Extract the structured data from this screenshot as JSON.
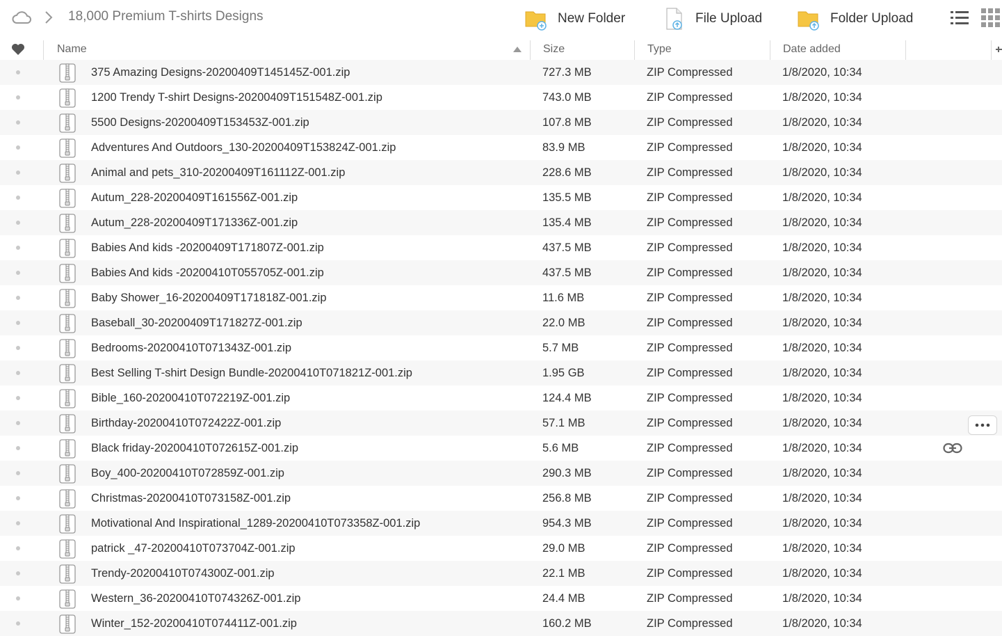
{
  "breadcrumb": {
    "title": "18,000 Premium T-shirts Designs"
  },
  "toolbar": {
    "new_folder": "New Folder",
    "file_upload": "File Upload",
    "folder_upload": "Folder Upload"
  },
  "colors": {
    "folder": "#f5c542",
    "accent_badge": "#5fb3e6",
    "stripe": "#f7f7f7"
  },
  "columns": {
    "name": "Name",
    "size": "Size",
    "type": "Type",
    "date": "Date added"
  },
  "files": [
    {
      "name": "375 Amazing Designs-20200409T145145Z-001.zip",
      "size": "727.3 MB",
      "type": "ZIP Compressed",
      "date": "1/8/2020, 10:34"
    },
    {
      "name": "1200 Trendy T-shirt Designs-20200409T151548Z-001.zip",
      "size": "743.0 MB",
      "type": "ZIP Compressed",
      "date": "1/8/2020, 10:34"
    },
    {
      "name": "5500 Designs-20200409T153453Z-001.zip",
      "size": "107.8 MB",
      "type": "ZIP Compressed",
      "date": "1/8/2020, 10:34"
    },
    {
      "name": "Adventures And Outdoors_130-20200409T153824Z-001.zip",
      "size": "83.9 MB",
      "type": "ZIP Compressed",
      "date": "1/8/2020, 10:34"
    },
    {
      "name": "Animal and pets_310-20200409T161112Z-001.zip",
      "size": "228.6 MB",
      "type": "ZIP Compressed",
      "date": "1/8/2020, 10:34"
    },
    {
      "name": "Autum_228-20200409T161556Z-001.zip",
      "size": "135.5 MB",
      "type": "ZIP Compressed",
      "date": "1/8/2020, 10:34"
    },
    {
      "name": "Autum_228-20200409T171336Z-001.zip",
      "size": "135.4 MB",
      "type": "ZIP Compressed",
      "date": "1/8/2020, 10:34"
    },
    {
      "name": "Babies And kids -20200409T171807Z-001.zip",
      "size": "437.5 MB",
      "type": "ZIP Compressed",
      "date": "1/8/2020, 10:34"
    },
    {
      "name": "Babies And kids -20200410T055705Z-001.zip",
      "size": "437.5 MB",
      "type": "ZIP Compressed",
      "date": "1/8/2020, 10:34"
    },
    {
      "name": "Baby Shower_16-20200409T171818Z-001.zip",
      "size": "11.6 MB",
      "type": "ZIP Compressed",
      "date": "1/8/2020, 10:34"
    },
    {
      "name": "Baseball_30-20200409T171827Z-001.zip",
      "size": "22.0 MB",
      "type": "ZIP Compressed",
      "date": "1/8/2020, 10:34"
    },
    {
      "name": "Bedrooms-20200410T071343Z-001.zip",
      "size": "5.7 MB",
      "type": "ZIP Compressed",
      "date": "1/8/2020, 10:34"
    },
    {
      "name": "Best Selling T-shirt Design Bundle-20200410T071821Z-001.zip",
      "size": "1.95 GB",
      "type": "ZIP Compressed",
      "date": "1/8/2020, 10:34"
    },
    {
      "name": "Bible_160-20200410T072219Z-001.zip",
      "size": "124.4 MB",
      "type": "ZIP Compressed",
      "date": "1/8/2020, 10:34"
    },
    {
      "name": "Birthday-20200410T072422Z-001.zip",
      "size": "57.1 MB",
      "type": "ZIP Compressed",
      "date": "1/8/2020, 10:34"
    },
    {
      "name": "Black friday-20200410T072615Z-001.zip",
      "size": "5.6 MB",
      "type": "ZIP Compressed",
      "date": "1/8/2020, 10:34"
    },
    {
      "name": "Boy_400-20200410T072859Z-001.zip",
      "size": "290.3 MB",
      "type": "ZIP Compressed",
      "date": "1/8/2020, 10:34"
    },
    {
      "name": "Christmas-20200410T073158Z-001.zip",
      "size": "256.8 MB",
      "type": "ZIP Compressed",
      "date": "1/8/2020, 10:34"
    },
    {
      "name": "Motivational And Inspirational_1289-20200410T073358Z-001.zip",
      "size": "954.3 MB",
      "type": "ZIP Compressed",
      "date": "1/8/2020, 10:34"
    },
    {
      "name": "patrick _47-20200410T073704Z-001.zip",
      "size": "29.0 MB",
      "type": "ZIP Compressed",
      "date": "1/8/2020, 10:34"
    },
    {
      "name": "Trendy-20200410T074300Z-001.zip",
      "size": "22.1 MB",
      "type": "ZIP Compressed",
      "date": "1/8/2020, 10:34"
    },
    {
      "name": "Western_36-20200410T074326Z-001.zip",
      "size": "24.4 MB",
      "type": "ZIP Compressed",
      "date": "1/8/2020, 10:34"
    },
    {
      "name": "Winter_152-20200410T074411Z-001.zip",
      "size": "160.2 MB",
      "type": "ZIP Compressed",
      "date": "1/8/2020, 10:34"
    }
  ]
}
